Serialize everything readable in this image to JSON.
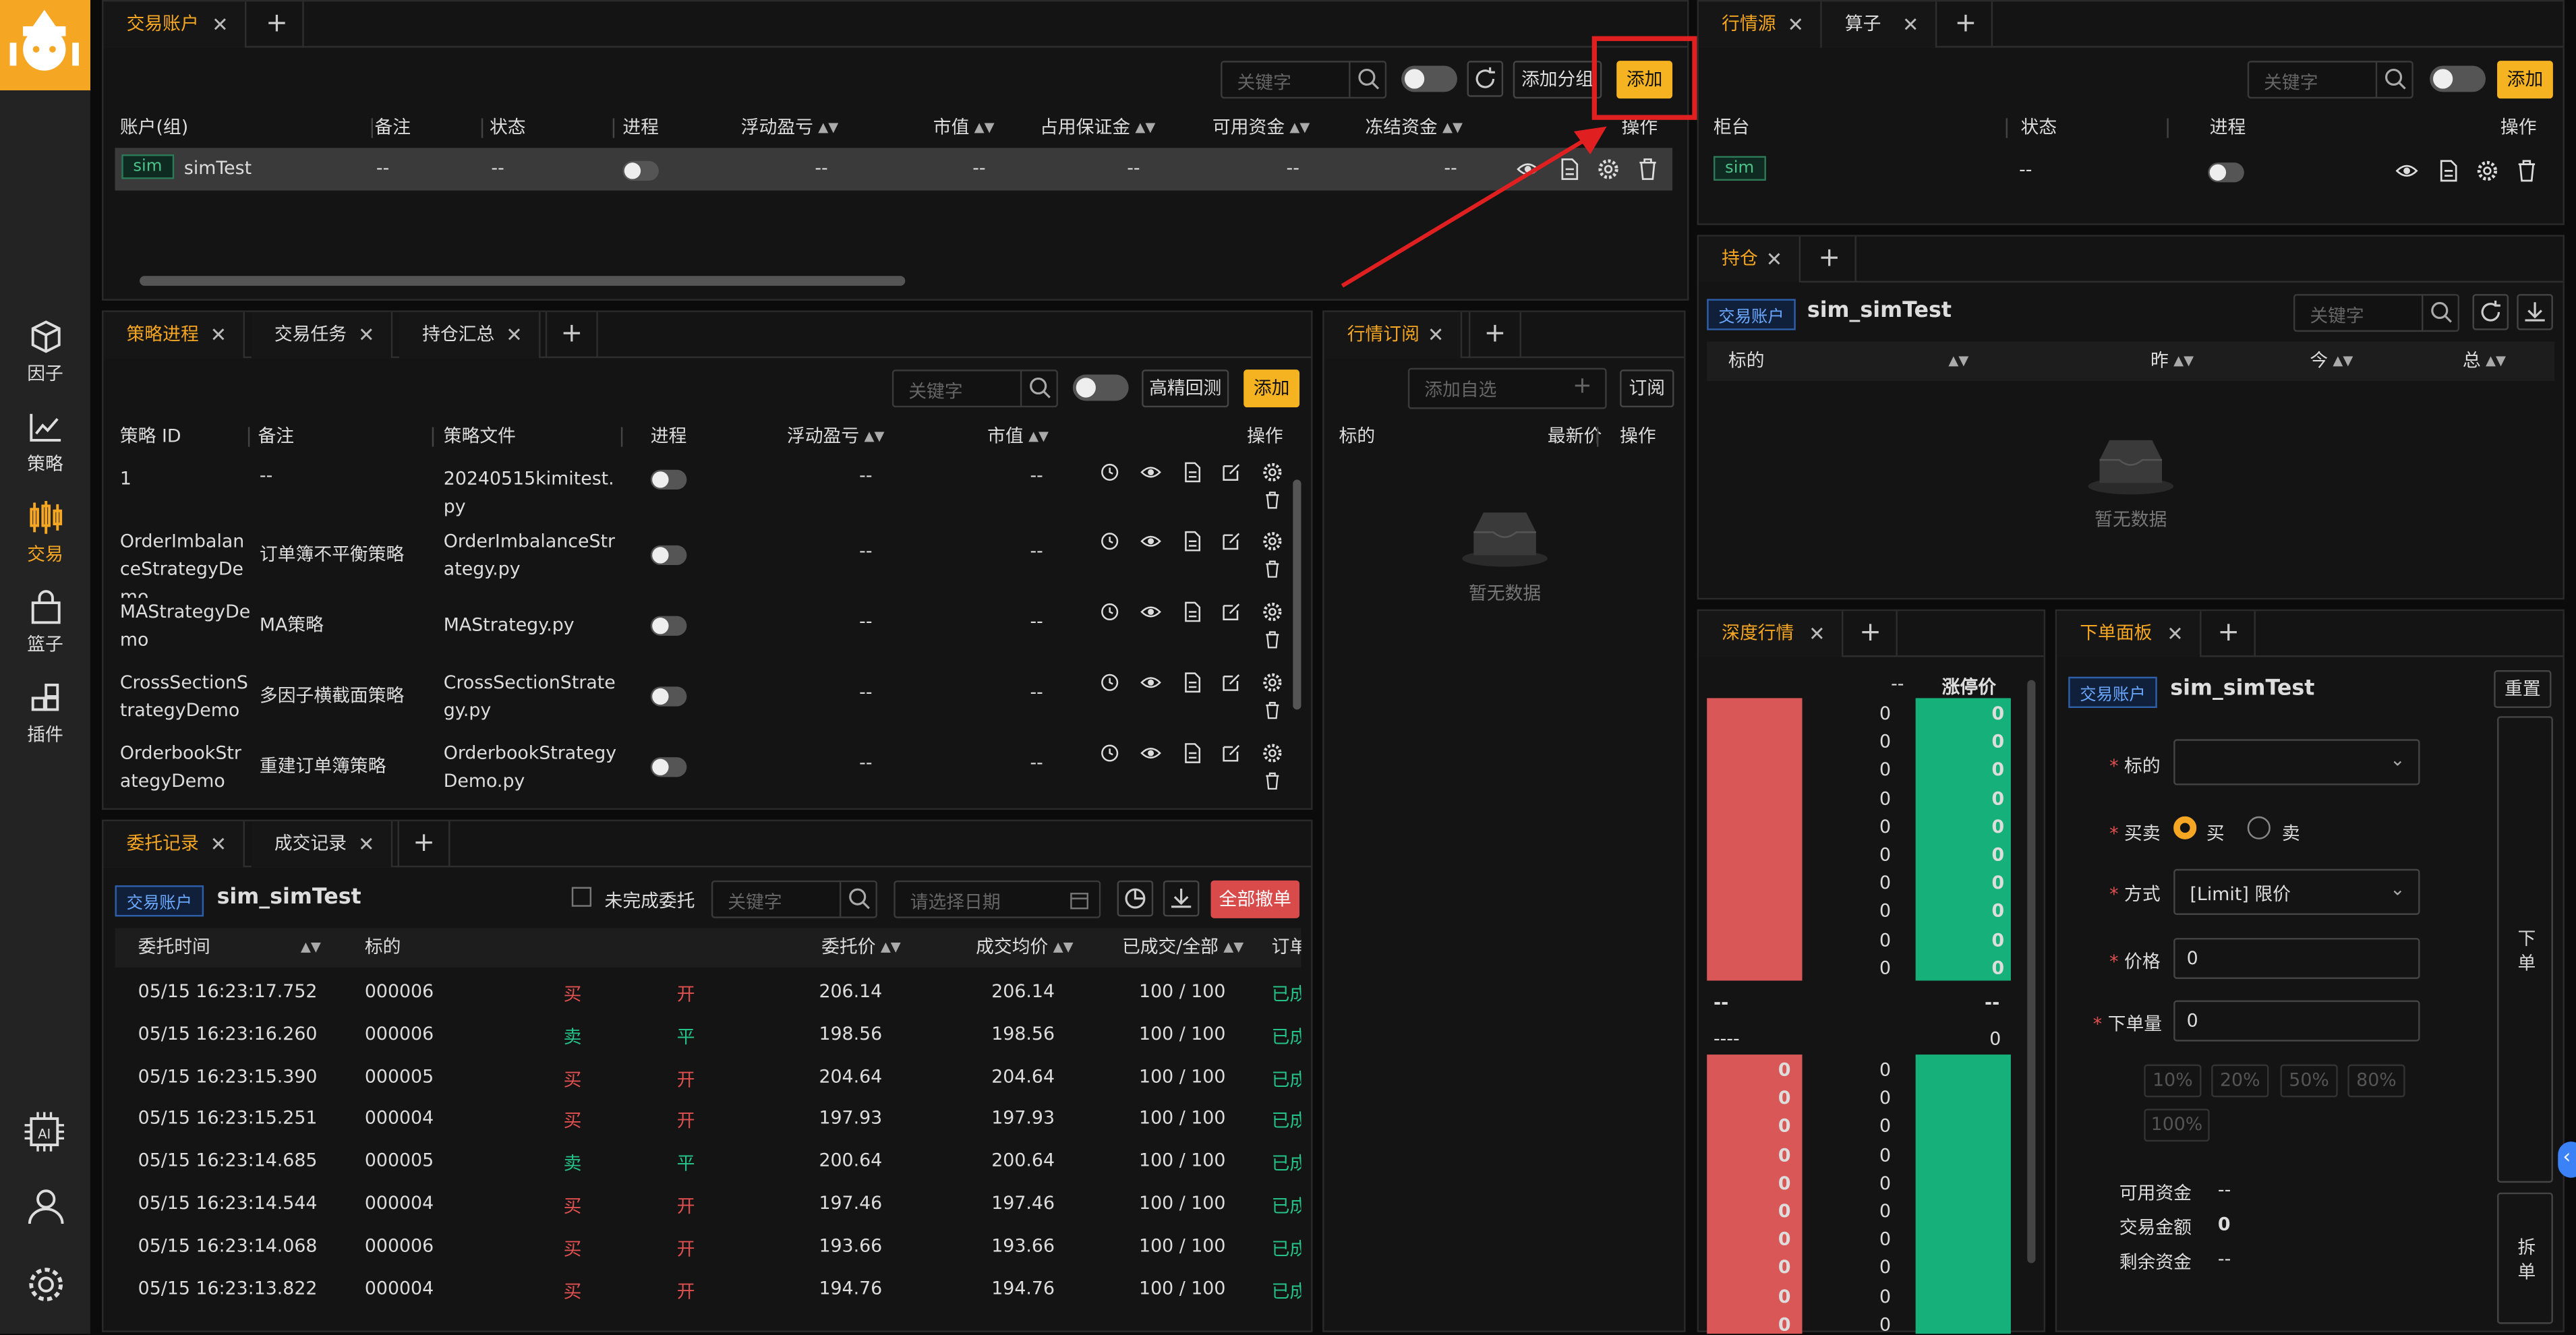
{
  "nav": {
    "items": [
      {
        "label": "因子",
        "icon": "cube-icon"
      },
      {
        "label": "策略",
        "icon": "chart-line-icon"
      },
      {
        "label": "交易",
        "icon": "trade-icon"
      },
      {
        "label": "篮子",
        "icon": "basket-icon"
      },
      {
        "label": "插件",
        "icon": "plugin-icon"
      }
    ],
    "bottom": [
      "ai-chip-icon",
      "user-icon",
      "settings-icon"
    ]
  },
  "accounts": {
    "tab": "交易账户",
    "search_ph": "关键字",
    "add_group": "添加分组",
    "add": "添加",
    "cols": [
      "账户(组)",
      "备注",
      "状态",
      "进程",
      "浮动盈亏",
      "市值",
      "占用保证金",
      "可用资金",
      "冻结资金",
      "操作"
    ],
    "row": {
      "tag": "sim",
      "name": "simTest",
      "remark": "--",
      "status": "--",
      "float": "--",
      "mv": "--",
      "margin": "--",
      "avail": "--",
      "frozen": "--"
    }
  },
  "sources": {
    "tabs": [
      "行情源",
      "算子"
    ],
    "search_ph": "关键字",
    "add": "添加",
    "cols": [
      "柜台",
      "状态",
      "进程",
      "操作"
    ],
    "row": {
      "tag": "sim",
      "status": "--"
    }
  },
  "positions": {
    "tab": "持仓",
    "acct_tag": "交易账户",
    "acct": "sim_simTest",
    "search_ph": "关键字",
    "cols": [
      "标的",
      "昨",
      "今",
      "总"
    ],
    "empty": "暂无数据"
  },
  "strategy": {
    "tabs": [
      "策略进程",
      "交易任务",
      "持仓汇总"
    ],
    "search_ph": "关键字",
    "backtest": "高精回测",
    "add": "添加",
    "cols": [
      "策略 ID",
      "备注",
      "策略文件",
      "进程",
      "浮动盈亏",
      "市值",
      "操作"
    ],
    "rows": [
      {
        "id": "1",
        "remark": "--",
        "file": "20240515kimitest.py",
        "float": "--",
        "mv": "--"
      },
      {
        "id": "OrderImbalanceStrategyDemo",
        "remark": "订单簿不平衡策略",
        "file": "OrderImbalanceStrategy.py",
        "float": "--",
        "mv": "--"
      },
      {
        "id": "MAStrategyDemo",
        "remark": "MA策略",
        "file": "MAStrategy.py",
        "float": "--",
        "mv": "--"
      },
      {
        "id": "CrossSectionStrategyDemo",
        "remark": "多因子横截面策略",
        "file": "CrossSectionStrategy.py",
        "float": "--",
        "mv": "--"
      },
      {
        "id": "OrderbookStrategyDemo",
        "remark": "重建订单簿策略",
        "file": "OrderbookStrategyDemo.py",
        "float": "--",
        "mv": "--"
      }
    ]
  },
  "subscribe": {
    "tab": "行情订阅",
    "add_ph": "添加自选",
    "sub": "订阅",
    "cols": [
      "标的",
      "最新价",
      "操作"
    ],
    "empty": "暂无数据"
  },
  "orders": {
    "tabs": [
      "委托记录",
      "成交记录"
    ],
    "acct_tag": "交易账户",
    "acct": "sim_simTest",
    "unfinished": "未完成委托",
    "search_ph": "关键字",
    "date_ph": "请选择日期",
    "cancel_all": "全部撤单",
    "cols": [
      "委托时间",
      "标的",
      "委托价",
      "成交均价",
      "已成交/全部",
      "订单"
    ],
    "rows": [
      {
        "time": "05/15 16:23:17.752",
        "sym": "000006",
        "side": "买",
        "oc": "开",
        "price": "206.14",
        "avg": "206.14",
        "fill": "100 / 100",
        "st": "已成"
      },
      {
        "time": "05/15 16:23:16.260",
        "sym": "000006",
        "side": "卖",
        "oc": "平",
        "price": "198.56",
        "avg": "198.56",
        "fill": "100 / 100",
        "st": "已成"
      },
      {
        "time": "05/15 16:23:15.390",
        "sym": "000005",
        "side": "买",
        "oc": "开",
        "price": "204.64",
        "avg": "204.64",
        "fill": "100 / 100",
        "st": "已成"
      },
      {
        "time": "05/15 16:23:15.251",
        "sym": "000004",
        "side": "买",
        "oc": "开",
        "price": "197.93",
        "avg": "197.93",
        "fill": "100 / 100",
        "st": "已成"
      },
      {
        "time": "05/15 16:23:14.685",
        "sym": "000005",
        "side": "卖",
        "oc": "平",
        "price": "200.64",
        "avg": "200.64",
        "fill": "100 / 100",
        "st": "已成"
      },
      {
        "time": "05/15 16:23:14.544",
        "sym": "000004",
        "side": "买",
        "oc": "开",
        "price": "197.46",
        "avg": "197.46",
        "fill": "100 / 100",
        "st": "已成"
      },
      {
        "time": "05/15 16:23:14.068",
        "sym": "000006",
        "side": "买",
        "oc": "开",
        "price": "193.66",
        "avg": "193.66",
        "fill": "100 / 100",
        "st": "已成"
      },
      {
        "time": "05/15 16:23:13.822",
        "sym": "000004",
        "side": "买",
        "oc": "开",
        "price": "194.76",
        "avg": "194.76",
        "fill": "100 / 100",
        "st": "已成"
      }
    ]
  },
  "depth": {
    "tab": "深度行情",
    "col1": "--",
    "col2": "涨停价",
    "zero": "0",
    "mid_l": "--",
    "mid_r": "--",
    "mid2_l": "----",
    "mid2_r": "0"
  },
  "orderpanel": {
    "tab": "下单面板",
    "acct_tag": "交易账户",
    "acct": "sim_simTest",
    "reset": "重置",
    "symbol": "标的",
    "side": "买卖",
    "buy": "买",
    "sell": "卖",
    "method": "方式",
    "method_val": "[Limit] 限价",
    "price": "价格",
    "price_val": "0",
    "qty": "下单量",
    "qty_val": "0",
    "pcts": [
      "10%",
      "20%",
      "50%",
      "80%",
      "100%"
    ],
    "avail": "可用资金",
    "avail_val": "--",
    "amount": "交易金额",
    "amount_val": "0",
    "remain": "剩余资金",
    "remain_val": "--",
    "place": "下单",
    "split": "拆单"
  },
  "colors": {
    "accent": "#f5a623",
    "buy": "#e05050",
    "sell": "#25c28a"
  }
}
